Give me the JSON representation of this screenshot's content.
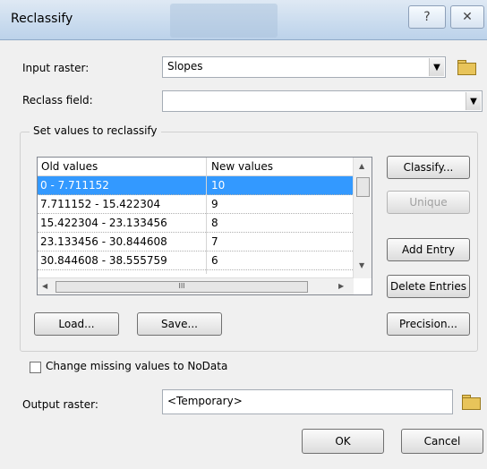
{
  "window": {
    "title": "Reclassify",
    "help_glyph": "?",
    "close_glyph": "✕"
  },
  "input_raster": {
    "label": "Input raster:",
    "value": "Slopes"
  },
  "reclass_field": {
    "label": "Reclass field:",
    "value": ""
  },
  "group": {
    "title": "Set values to reclassify",
    "columns": [
      "Old values",
      "New values"
    ],
    "rows": [
      {
        "old": "0 - 7.711152",
        "new": "10"
      },
      {
        "old": "7.711152 - 15.422304",
        "new": "9"
      },
      {
        "old": "15.422304 - 23.133456",
        "new": "8"
      },
      {
        "old": "23.133456 - 30.844608",
        "new": "7"
      },
      {
        "old": "30.844608 - 38.555759",
        "new": "6"
      }
    ],
    "hscroll_grip": "III"
  },
  "buttons": {
    "classify": "Classify...",
    "unique": "Unique",
    "add_entry": "Add Entry",
    "delete_entries": "Delete Entries",
    "load": "Load...",
    "save": "Save...",
    "precision": "Precision...",
    "ok": "OK",
    "cancel": "Cancel"
  },
  "change_missing": {
    "label": "Change missing values to NoData",
    "checked": false
  },
  "output_raster": {
    "label": "Output raster:",
    "value": "<Temporary>"
  },
  "icons": [
    "help-icon",
    "close-icon",
    "dropdown-arrow-icon",
    "open-folder-icon",
    "scroll-arrow-icon"
  ]
}
